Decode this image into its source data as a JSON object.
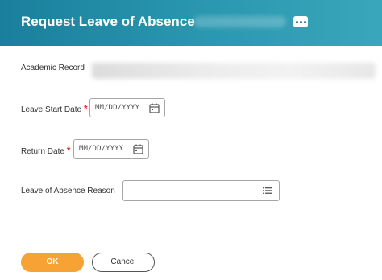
{
  "header": {
    "title": "Request Leave of Absence",
    "more_icon": "more-horizontal-icon",
    "background_color": "#1f88a4"
  },
  "form": {
    "academic_record_label": "Academic Record",
    "leave_start_label": "Leave Start Date",
    "leave_start_placeholder": "MM/DD/YYYY",
    "return_date_label": "Return Date",
    "return_date_placeholder": "MM/DD/YYYY",
    "reason_label": "Leave of Absence Reason",
    "reason_value": "",
    "required_marker": "*",
    "calendar_icon": "calendar-icon",
    "list_icon": "list-prompt-icon"
  },
  "footer": {
    "ok_label": "OK",
    "cancel_label": "Cancel",
    "ok_color": "#f7a234"
  }
}
